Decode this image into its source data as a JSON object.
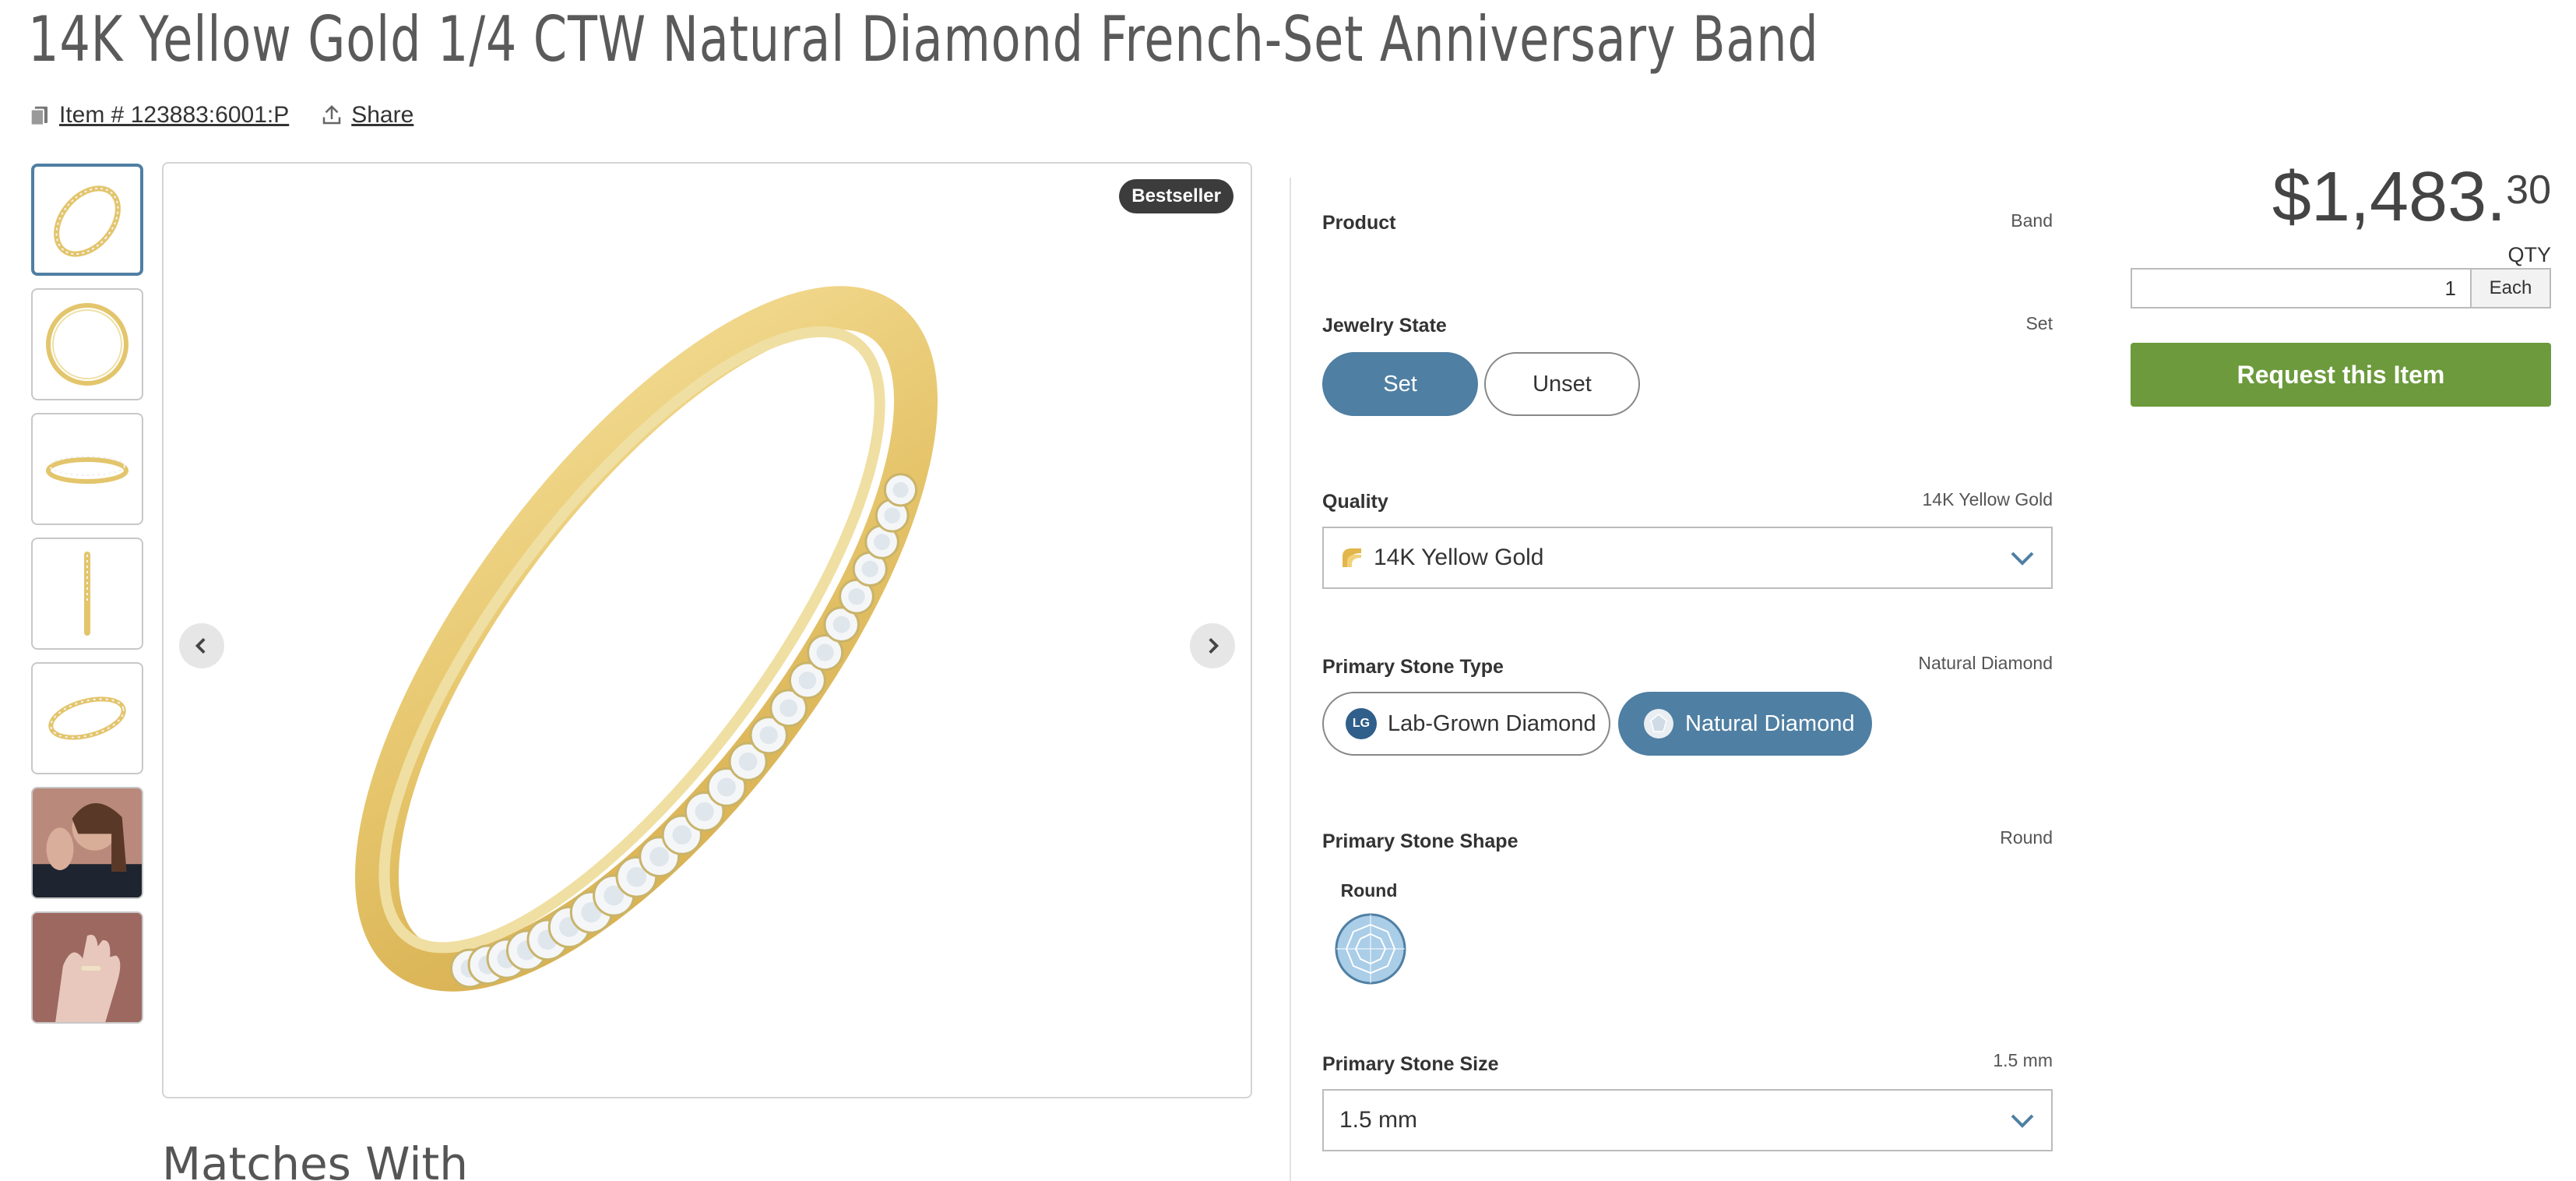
{
  "product": {
    "title": "14K Yellow Gold 1/4 CTW Natural Diamond French-Set Anniversary Band",
    "item_number": "Item # 123883:6001:P",
    "share_label": "Share",
    "badge": "Bestseller"
  },
  "gallery": {
    "thumbnail_count": 7,
    "selected_index": 0
  },
  "options": {
    "product_label": "Product",
    "product_value": "Band",
    "jewelry_state_label": "Jewelry State",
    "jewelry_state_value": "Set",
    "jewelry_state_options": [
      "Set",
      "Unset"
    ],
    "quality_label": "Quality",
    "quality_value": "14K Yellow Gold",
    "quality_selected": "14K Yellow Gold",
    "stone_type_label": "Primary Stone Type",
    "stone_type_value": "Natural Diamond",
    "stone_type_options": [
      "Lab-Grown Diamond",
      "Natural Diamond"
    ],
    "stone_type_lg_badge": "LG",
    "stone_shape_label": "Primary Stone Shape",
    "stone_shape_value": "Round",
    "stone_shape_option": "Round",
    "stone_size_label": "Primary Stone Size",
    "stone_size_value": "1.5 mm",
    "stone_size_selected": "1.5 mm"
  },
  "purchase": {
    "price_main": "$1,483.",
    "price_cents": "30",
    "qty_label": "QTY",
    "qty_value": "1",
    "qty_unit": "Each",
    "request_label": "Request this Item"
  },
  "matches_heading": "Matches With",
  "colors": {
    "accent_blue": "#4f7fa3",
    "request_green": "#6c9a3c",
    "gold": "#e8cc74"
  }
}
